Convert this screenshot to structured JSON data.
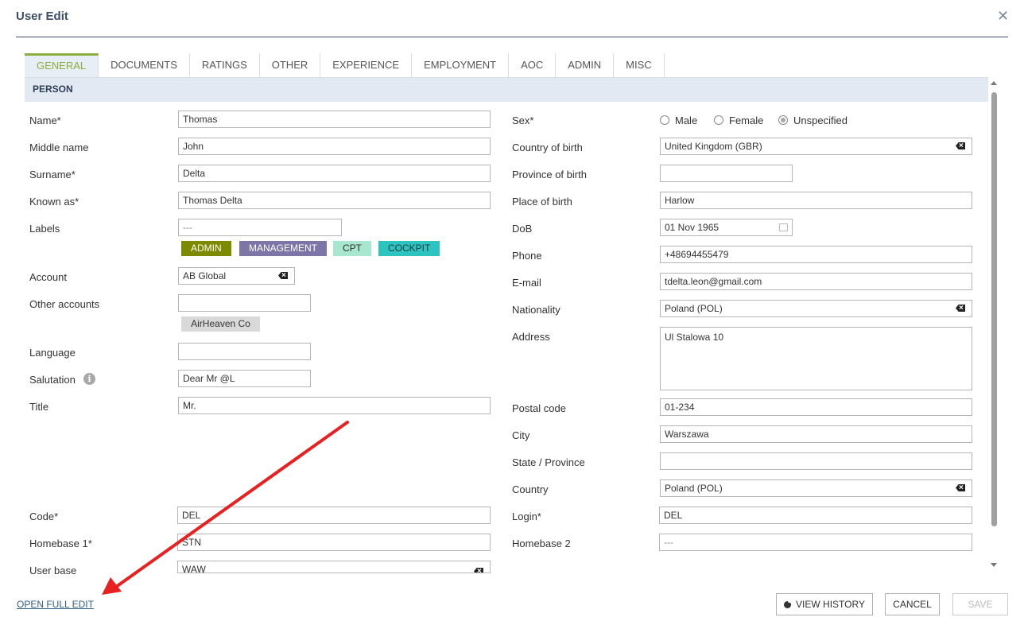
{
  "dialog": {
    "title": "User Edit"
  },
  "tabs": [
    {
      "label": "GENERAL"
    },
    {
      "label": "DOCUMENTS"
    },
    {
      "label": "RATINGS"
    },
    {
      "label": "OTHER"
    },
    {
      "label": "EXPERIENCE"
    },
    {
      "label": "EMPLOYMENT"
    },
    {
      "label": "AOC"
    },
    {
      "label": "ADMIN"
    },
    {
      "label": "MISC"
    }
  ],
  "section": {
    "title": "PERSON"
  },
  "left": {
    "name": {
      "label": "Name*",
      "value": "Thomas"
    },
    "middle_name": {
      "label": "Middle name",
      "value": "John"
    },
    "surname": {
      "label": "Surname*",
      "value": "Delta"
    },
    "known_as": {
      "label": "Known as*",
      "value": "Thomas Delta"
    },
    "labels": {
      "label": "Labels",
      "value": "---",
      "chips": [
        {
          "text": "ADMIN",
          "bg": "#7c8a00",
          "fg": "#ffffff"
        },
        {
          "text": "MANAGEMENT",
          "bg": "#7d74a8",
          "fg": "#ffffff"
        },
        {
          "text": "CPT",
          "bg": "#a7e6cf",
          "fg": "#333333"
        },
        {
          "text": "COCKPIT",
          "bg": "#2cc3c0",
          "fg": "#1a3a3a"
        }
      ]
    },
    "account": {
      "label": "Account",
      "value": "AB Global"
    },
    "other_accounts": {
      "label": "Other accounts",
      "value": "",
      "chip": "AirHeaven Co"
    },
    "language": {
      "label": "Language",
      "value": ""
    },
    "salutation": {
      "label": "Salutation",
      "value": "Dear Mr @L"
    },
    "title": {
      "label": "Title",
      "value": "Mr."
    },
    "code": {
      "label": "Code*",
      "value": "DEL"
    },
    "homebase1": {
      "label": "Homebase 1*",
      "value": "STN"
    },
    "user_base": {
      "label": "User base",
      "value": "WAW"
    }
  },
  "right": {
    "sex": {
      "label": "Sex*",
      "options": [
        "Male",
        "Female",
        "Unspecified"
      ],
      "selected": "Unspecified"
    },
    "country_of_birth": {
      "label": "Country of birth",
      "value": "United Kingdom (GBR)"
    },
    "province_of_birth": {
      "label": "Province of birth",
      "value": ""
    },
    "place_of_birth": {
      "label": "Place of birth",
      "value": "Harlow"
    },
    "dob": {
      "label": "DoB",
      "value": "01 Nov 1965"
    },
    "phone": {
      "label": "Phone",
      "value": "+48694455479"
    },
    "email": {
      "label": "E-mail",
      "value": "tdelta.leon@gmail.com"
    },
    "nationality": {
      "label": "Nationality",
      "value": "Poland (POL)"
    },
    "address": {
      "label": "Address",
      "value": "Ul Stalowa 10"
    },
    "postal_code": {
      "label": "Postal code",
      "value": "01-234"
    },
    "city": {
      "label": "City",
      "value": "Warszawa"
    },
    "state": {
      "label": "State / Province",
      "value": ""
    },
    "country": {
      "label": "Country",
      "value": "Poland (POL)"
    },
    "login": {
      "label": "Login*",
      "value": "DEL"
    },
    "homebase2": {
      "label": "Homebase 2",
      "value": "---"
    }
  },
  "footer": {
    "open_full_edit": "OPEN FULL EDIT",
    "view_history": "VIEW HISTORY",
    "cancel": "CANCEL",
    "save": "SAVE"
  },
  "colors": {
    "accent": "#8ab03b",
    "heading": "#3c4f66",
    "annotation_arrow": "#e8201f"
  },
  "icons": {
    "close": "close-icon",
    "info": "info-icon",
    "history": "history-icon",
    "calendar": "calendar-icon",
    "clear": "clear-input-icon"
  }
}
